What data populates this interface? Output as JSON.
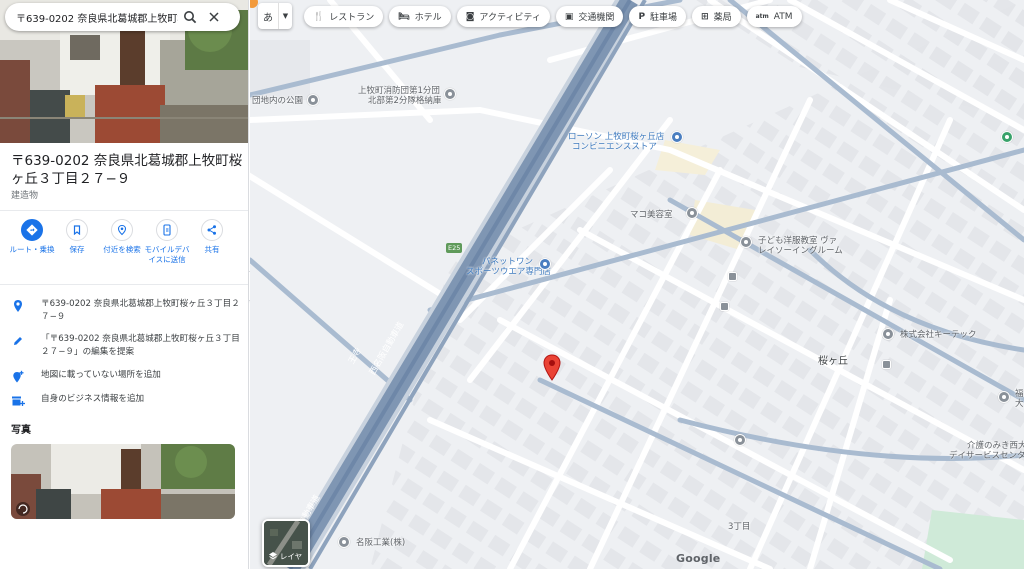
{
  "search": {
    "value": "〒639-0202 奈良県北葛城郡上牧町桜"
  },
  "place": {
    "title": "〒639-0202 奈良県北葛城郡上牧町桜ヶ丘３丁目２７−９",
    "category": "建造物"
  },
  "actions": [
    {
      "label": "ルート・乗換",
      "icon": "directions-icon"
    },
    {
      "label": "保存",
      "icon": "bookmark-icon"
    },
    {
      "label": "付近を検索",
      "icon": "nearby-icon"
    },
    {
      "label": "モバイルデバイスに送信",
      "icon": "send-to-phone-icon"
    },
    {
      "label": "共有",
      "icon": "share-icon"
    }
  ],
  "info": {
    "address": "〒639-0202 奈良県北葛城郡上牧町桜ヶ丘３丁目２７−９",
    "suggest_edit": "「〒639-0202 奈良県北葛城郡上牧町桜ヶ丘３丁目２７−９」の編集を提案",
    "add_missing": "地図に載っていない場所を追加",
    "add_business": "自身のビジネス情報を追加"
  },
  "photos_heading": "写真",
  "map": {
    "language_chip": "あ",
    "chips": [
      {
        "label": "レストラン",
        "icon": "restaurant-icon"
      },
      {
        "label": "ホテル",
        "icon": "hotel-icon"
      },
      {
        "label": "アクティビティ",
        "icon": "camera-icon"
      },
      {
        "label": "交通機関",
        "icon": "transit-icon"
      },
      {
        "label": "駐車場",
        "icon": "parking-icon"
      },
      {
        "label": "薬局",
        "icon": "pharmacy-icon"
      },
      {
        "label": "ATM",
        "icon": "atm-icon"
      }
    ],
    "labels": {
      "park": "団地内の公園",
      "fire1": "上牧町消防団第1分団",
      "fire2": "北部第2分隊格納庫",
      "lawson1": "ローソン 上牧町桜ヶ丘店",
      "lawson2": "コンビニエンスストア",
      "salon": "マコ美容室",
      "kids1": "子ども洋服教室 ヴァ",
      "kids2": "レイソーイングルーム",
      "panet1": "パネットワン",
      "panet2": "スポーツウエア専門店",
      "route": "E25",
      "rail1": "王寺",
      "rail2": "線",
      "hwy1": "西名阪自動車道",
      "hwy2": "西名阪自動車道",
      "rail3": "王寺",
      "rail4": "線",
      "kk": "株式会社キーテック",
      "sakuragaoka": "桜ヶ丘",
      "kaigo1": "介護のみき西大",
      "kaigo2": "デイサービスセンタ",
      "chome": "3丁目",
      "meihan": "名阪工業(株)",
      "edge": "福",
      "edge2": "大"
    },
    "layers_label": "レイヤ",
    "attribution": "Google"
  }
}
